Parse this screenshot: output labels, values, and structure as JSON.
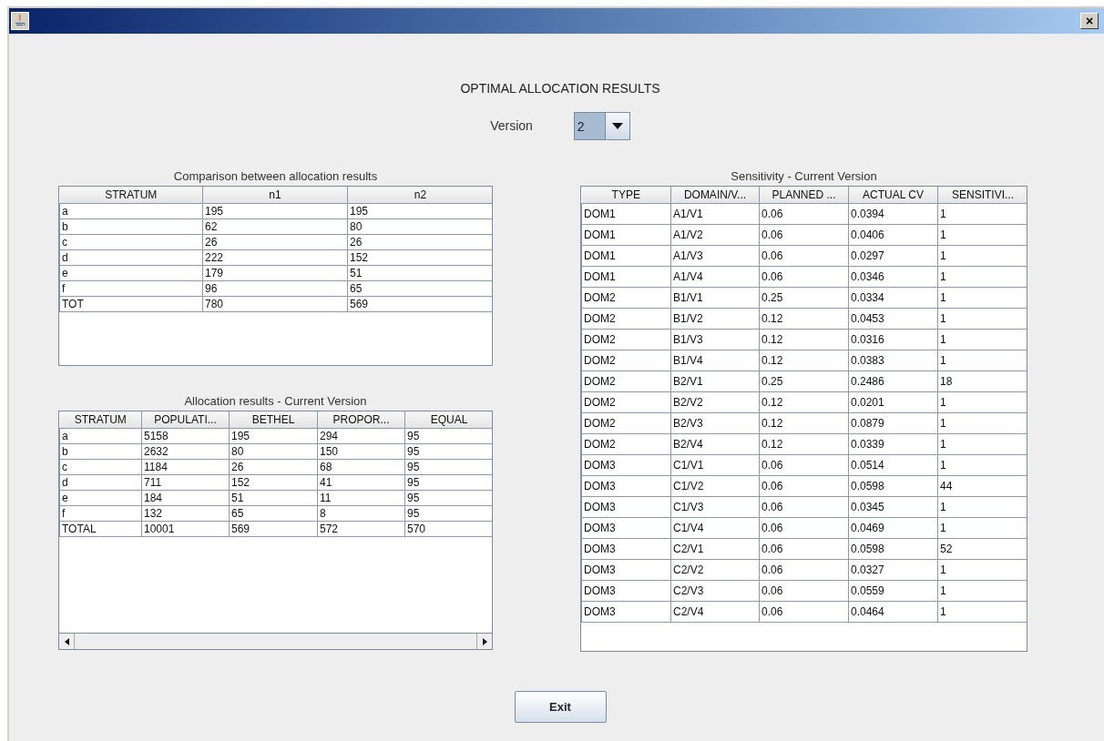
{
  "window": {
    "close": "×"
  },
  "heading": "OPTIMAL ALLOCATION RESULTS",
  "version": {
    "label": "Version",
    "value": "2"
  },
  "comparison": {
    "caption": "Comparison between allocation results",
    "columns": [
      "STRATUM",
      "n1",
      "n2"
    ],
    "rows": [
      [
        "a",
        "195",
        "195"
      ],
      [
        "b",
        "62",
        "80"
      ],
      [
        "c",
        "26",
        "26"
      ],
      [
        "d",
        "222",
        "152"
      ],
      [
        "e",
        "179",
        "51"
      ],
      [
        "f",
        "96",
        "65"
      ],
      [
        "TOT",
        "780",
        "569"
      ]
    ]
  },
  "allocation": {
    "caption": "Allocation results - Current Version",
    "columns": [
      "STRATUM",
      "POPULATI...",
      "BETHEL",
      "PROPOR...",
      "EQUAL"
    ],
    "rows": [
      [
        "a",
        "5158",
        "195",
        "294",
        "95"
      ],
      [
        "b",
        "2632",
        "80",
        "150",
        "95"
      ],
      [
        "c",
        "1184",
        "26",
        "68",
        "95"
      ],
      [
        "d",
        "711",
        "152",
        "41",
        "95"
      ],
      [
        "e",
        "184",
        "51",
        "11",
        "95"
      ],
      [
        "f",
        "132",
        "65",
        "8",
        "95"
      ],
      [
        "TOTAL",
        "10001",
        "569",
        "572",
        "570"
      ]
    ]
  },
  "sensitivity": {
    "caption": "Sensitivity - Current Version",
    "columns": [
      "TYPE",
      "DOMAIN/V...",
      "PLANNED ...",
      "ACTUAL CV",
      "SENSITIVI..."
    ],
    "rows": [
      [
        "DOM1",
        "A1/V1",
        "0.06",
        "0.0394",
        "1"
      ],
      [
        "DOM1",
        "A1/V2",
        "0.06",
        "0.0406",
        "1"
      ],
      [
        "DOM1",
        "A1/V3",
        "0.06",
        "0.0297",
        "1"
      ],
      [
        "DOM1",
        "A1/V4",
        "0.06",
        "0.0346",
        "1"
      ],
      [
        "DOM2",
        "B1/V1",
        "0.25",
        "0.0334",
        "1"
      ],
      [
        "DOM2",
        "B1/V2",
        "0.12",
        "0.0453",
        "1"
      ],
      [
        "DOM2",
        "B1/V3",
        "0.12",
        "0.0316",
        "1"
      ],
      [
        "DOM2",
        "B1/V4",
        "0.12",
        "0.0383",
        "1"
      ],
      [
        "DOM2",
        "B2/V1",
        "0.25",
        "0.2486",
        "18"
      ],
      [
        "DOM2",
        "B2/V2",
        "0.12",
        "0.0201",
        "1"
      ],
      [
        "DOM2",
        "B2/V3",
        "0.12",
        "0.0879",
        "1"
      ],
      [
        "DOM2",
        "B2/V4",
        "0.12",
        "0.0339",
        "1"
      ],
      [
        "DOM3",
        "C1/V1",
        "0.06",
        "0.0514",
        "1"
      ],
      [
        "DOM3",
        "C1/V2",
        "0.06",
        "0.0598",
        "44"
      ],
      [
        "DOM3",
        "C1/V3",
        "0.06",
        "0.0345",
        "1"
      ],
      [
        "DOM3",
        "C1/V4",
        "0.06",
        "0.0469",
        "1"
      ],
      [
        "DOM3",
        "C2/V1",
        "0.06",
        "0.0598",
        "52"
      ],
      [
        "DOM3",
        "C2/V2",
        "0.06",
        "0.0327",
        "1"
      ],
      [
        "DOM3",
        "C2/V3",
        "0.06",
        "0.0559",
        "1"
      ],
      [
        "DOM3",
        "C2/V4",
        "0.06",
        "0.0464",
        "1"
      ]
    ]
  },
  "exit_button": "Exit"
}
